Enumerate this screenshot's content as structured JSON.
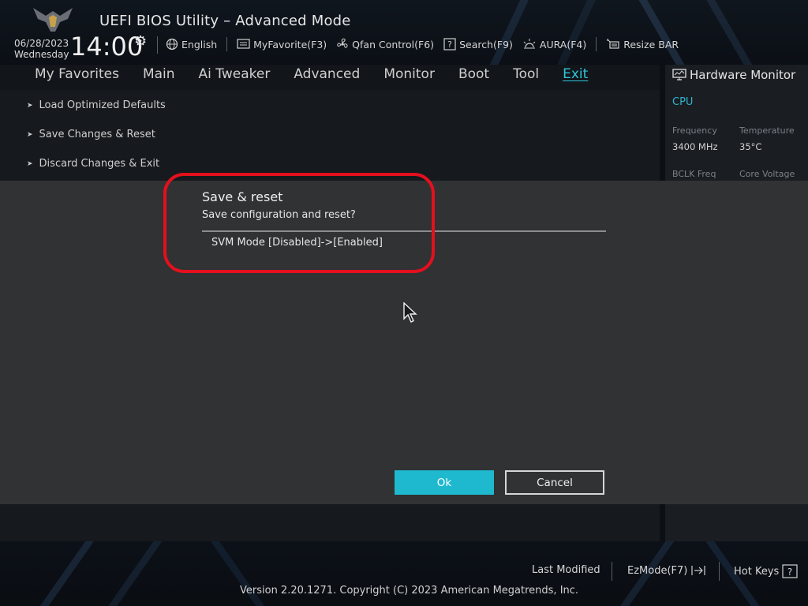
{
  "header": {
    "app_title": "UEFI BIOS Utility – Advanced Mode",
    "date": "06/28/2023",
    "weekday": "Wednesday",
    "time": "14:00"
  },
  "toolbar": {
    "language": "English",
    "my_favorite": "MyFavorite(F3)",
    "qfan": "Qfan Control(F6)",
    "search": "Search(F9)",
    "aura": "AURA(F4)",
    "resize_bar": "Resize BAR"
  },
  "nav": {
    "tabs": [
      "My Favorites",
      "Main",
      "Ai Tweaker",
      "Advanced",
      "Monitor",
      "Boot",
      "Tool",
      "Exit"
    ],
    "active": "Exit"
  },
  "exit_menu": {
    "items": [
      "Load Optimized Defaults",
      "Save Changes & Reset",
      "Discard Changes & Exit"
    ]
  },
  "hardware_monitor": {
    "title": "Hardware Monitor",
    "section": "CPU",
    "frequency_label": "Frequency",
    "frequency_value": "3400 MHz",
    "temperature_label": "Temperature",
    "temperature_value": "35°C",
    "bclk_label": "BCLK Freq",
    "core_voltage_label": "Core Voltage"
  },
  "dialog": {
    "title": "Save & reset",
    "subtitle": "Save configuration and reset?",
    "change": "SVM Mode [Disabled]->[Enabled]",
    "ok_label": "Ok",
    "cancel_label": "Cancel"
  },
  "footer": {
    "last_modified": "Last Modified",
    "ezmode": "EzMode(F7)",
    "hot_keys": "Hot Keys",
    "copyright": "Version 2.20.1271. Copyright (C) 2023 American Megatrends, Inc."
  },
  "colors": {
    "accent": "#1fb9cf",
    "highlight_ring": "#e3101d",
    "dialog_bg": "#303234"
  },
  "icons": {
    "settings": "gear-icon",
    "language": "globe-icon",
    "favorite": "favorite-list-icon",
    "fan": "fan-icon",
    "search": "question-box-icon",
    "aura": "aura-light-icon",
    "resize_bar": "resize-bar-icon",
    "monitor": "monitor-icon",
    "ezmode": "exit-arrow-icon",
    "hot_keys": "question-box-icon"
  }
}
